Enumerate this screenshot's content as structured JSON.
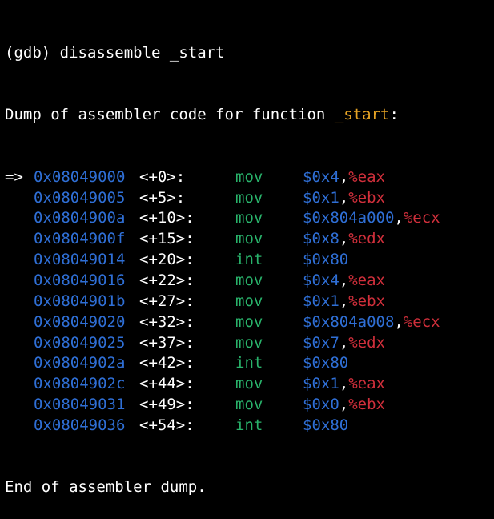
{
  "command_line": "(gdb) disassemble _start",
  "dump_header": {
    "prefix": "Dump of assembler code for function ",
    "function_name": "_start",
    "suffix": ":"
  },
  "current_marker": "=>",
  "instructions": [
    {
      "addr": "0x08049000",
      "offset": "<+0>:",
      "mnemonic": "mov",
      "src": "$0x4",
      "dst": "%eax"
    },
    {
      "addr": "0x08049005",
      "offset": "<+5>:",
      "mnemonic": "mov",
      "src": "$0x1",
      "dst": "%ebx"
    },
    {
      "addr": "0x0804900a",
      "offset": "<+10>:",
      "mnemonic": "mov",
      "src": "$0x804a000",
      "dst": "%ecx"
    },
    {
      "addr": "0x0804900f",
      "offset": "<+15>:",
      "mnemonic": "mov",
      "src": "$0x8",
      "dst": "%edx"
    },
    {
      "addr": "0x08049014",
      "offset": "<+20>:",
      "mnemonic": "int",
      "src": "$0x80",
      "dst": ""
    },
    {
      "addr": "0x08049016",
      "offset": "<+22>:",
      "mnemonic": "mov",
      "src": "$0x4",
      "dst": "%eax"
    },
    {
      "addr": "0x0804901b",
      "offset": "<+27>:",
      "mnemonic": "mov",
      "src": "$0x1",
      "dst": "%ebx"
    },
    {
      "addr": "0x08049020",
      "offset": "<+32>:",
      "mnemonic": "mov",
      "src": "$0x804a008",
      "dst": "%ecx"
    },
    {
      "addr": "0x08049025",
      "offset": "<+37>:",
      "mnemonic": "mov",
      "src": "$0x7",
      "dst": "%edx"
    },
    {
      "addr": "0x0804902a",
      "offset": "<+42>:",
      "mnemonic": "int",
      "src": "$0x80",
      "dst": ""
    },
    {
      "addr": "0x0804902c",
      "offset": "<+44>:",
      "mnemonic": "mov",
      "src": "$0x1",
      "dst": "%eax"
    },
    {
      "addr": "0x08049031",
      "offset": "<+49>:",
      "mnemonic": "mov",
      "src": "$0x0",
      "dst": "%ebx"
    },
    {
      "addr": "0x08049036",
      "offset": "<+54>:",
      "mnemonic": "int",
      "src": "$0x80",
      "dst": ""
    }
  ],
  "footer": "End of assembler dump.",
  "colors": {
    "background": "#000000",
    "address": "#2f6fd6",
    "mnemonic": "#29b36b",
    "register": "#d02f3b",
    "function_name": "#e6a324",
    "text": "#ffffff"
  }
}
